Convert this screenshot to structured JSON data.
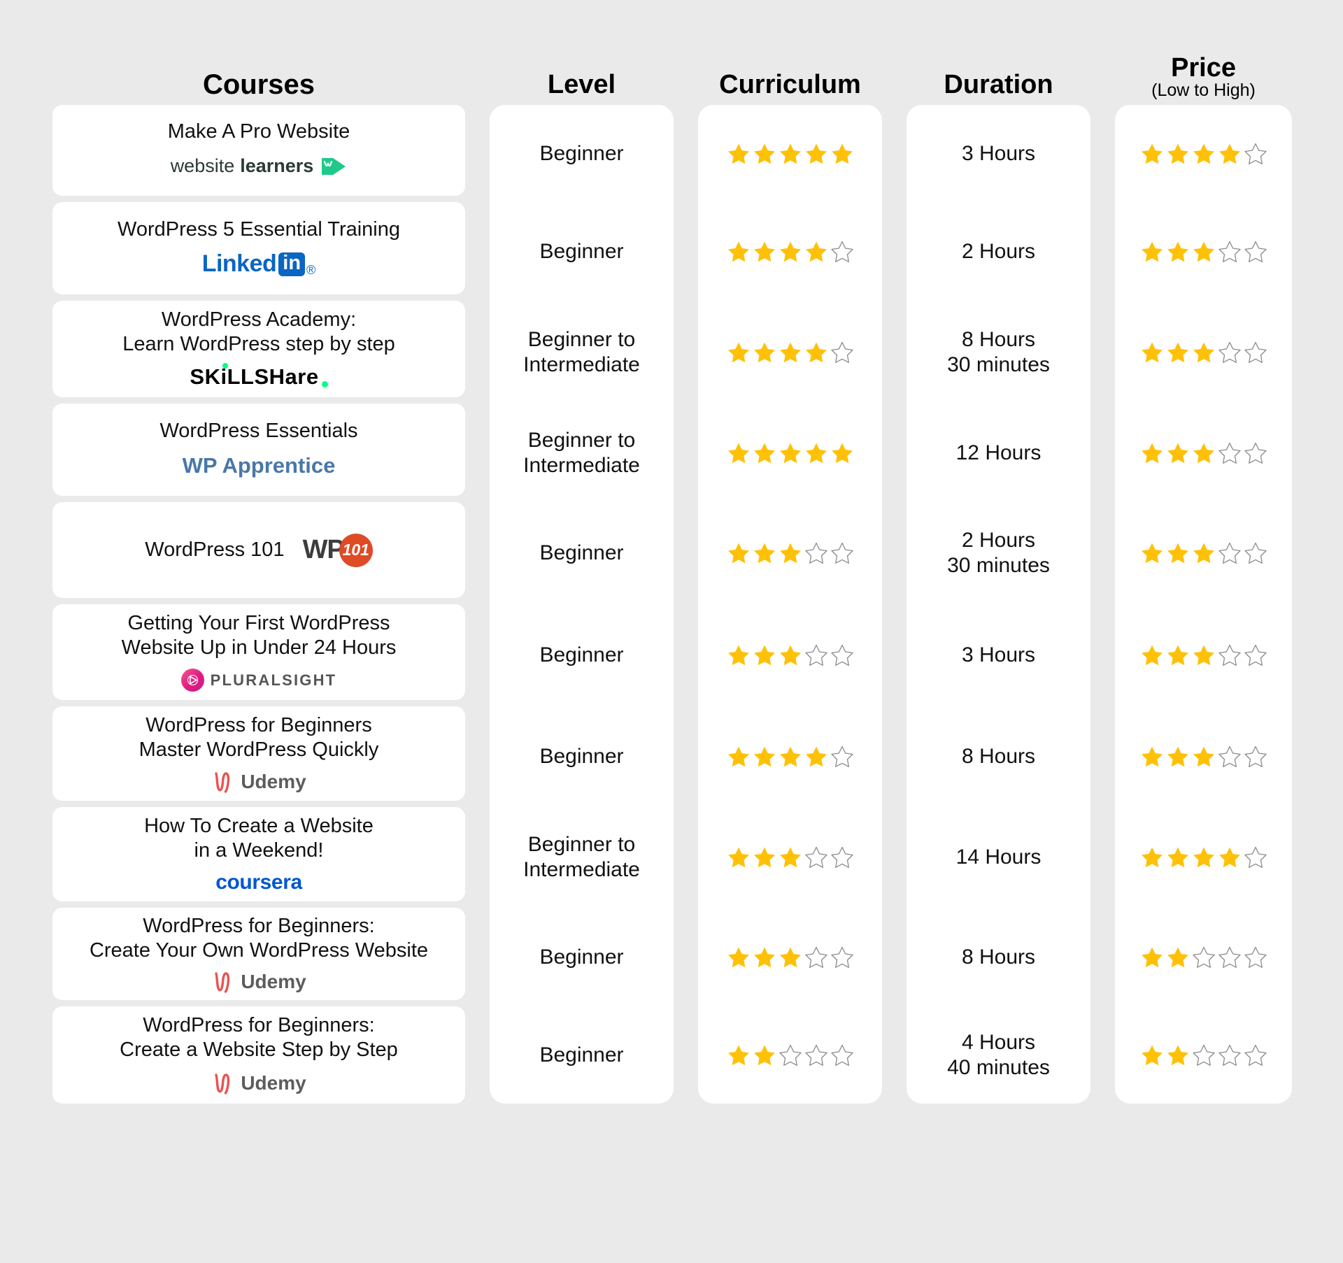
{
  "header": {
    "courses": "Courses",
    "level": "Level",
    "curriculum": "Curriculum",
    "duration": "Duration",
    "price": "Price",
    "price_sub": "(Low to High)"
  },
  "colors": {
    "page_background": "#EAEAEA",
    "card_background": "#FFFFFF",
    "star_filled": "#FFC107",
    "star_empty_stroke": "#8A8A8A",
    "text": "#111111",
    "linkedin_blue": "#0A66C2",
    "coursera_blue": "#0056D2",
    "wp_apprentice_blue": "#4A77A8",
    "wp101_orange": "#DE4B25",
    "udemy_red": "#EB5252",
    "skillshare_green": "#00FF84",
    "websitelearners_green": "#1EC98B",
    "pluralsight_pink": "#E3197F"
  },
  "rating_max": 5,
  "rows": [
    {
      "title": "Make A Pro Website",
      "provider": "websitelearners",
      "provider_icon": "websitelearners-logo",
      "level": "Beginner",
      "curriculum_rating": 5,
      "duration": "3 Hours",
      "price_rating": 4,
      "layout": "stacked"
    },
    {
      "title": "WordPress 5 Essential Training",
      "provider": "LinkedIn",
      "provider_icon": "linkedin-logo",
      "level": "Beginner",
      "curriculum_rating": 4,
      "duration": "2 Hours",
      "price_rating": 3,
      "layout": "stacked"
    },
    {
      "title": "WordPress Academy:\nLearn WordPress step by step",
      "provider": "Skillshare",
      "provider_icon": "skillshare-logo",
      "level": "Beginner to\nIntermediate",
      "curriculum_rating": 4,
      "duration": "8 Hours\n30 minutes",
      "price_rating": 3,
      "layout": "stacked"
    },
    {
      "title": "WordPress Essentials",
      "provider": "WP Apprentice",
      "provider_icon": "wp-apprentice-logo",
      "level": "Beginner to\nIntermediate",
      "curriculum_rating": 5,
      "duration": "12 Hours",
      "price_rating": 3,
      "layout": "stacked"
    },
    {
      "title": "WordPress 101",
      "provider": "WP101",
      "provider_icon": "wp101-logo",
      "level": "Beginner",
      "curriculum_rating": 3,
      "duration": "2 Hours\n30 minutes",
      "price_rating": 3,
      "layout": "inline"
    },
    {
      "title": "Getting Your First WordPress\nWebsite Up in Under 24 Hours",
      "provider": "PLURALSIGHT",
      "provider_icon": "pluralsight-logo",
      "level": "Beginner",
      "curriculum_rating": 3,
      "duration": "3 Hours",
      "price_rating": 3,
      "layout": "stacked"
    },
    {
      "title": "WordPress for Beginners\nMaster WordPress Quickly",
      "provider": "Udemy",
      "provider_icon": "udemy-logo",
      "level": "Beginner",
      "curriculum_rating": 4,
      "duration": "8 Hours",
      "price_rating": 3,
      "layout": "stacked"
    },
    {
      "title": "How To Create a Website\nin a Weekend!",
      "provider": "coursera",
      "provider_icon": "coursera-logo",
      "level": "Beginner to\nIntermediate",
      "curriculum_rating": 3,
      "duration": "14 Hours",
      "price_rating": 4,
      "layout": "stacked"
    },
    {
      "title": "WordPress for Beginners:\nCreate Your Own WordPress Website",
      "provider": "Udemy",
      "provider_icon": "udemy-logo",
      "level": "Beginner",
      "curriculum_rating": 3,
      "duration": "8 Hours",
      "price_rating": 2,
      "layout": "stacked"
    },
    {
      "title": "WordPress for Beginners:\nCreate a Website Step by Step",
      "provider": "Udemy",
      "provider_icon": "udemy-logo",
      "level": "Beginner",
      "curriculum_rating": 2,
      "duration": "4 Hours\n40 minutes",
      "price_rating": 2,
      "layout": "stacked"
    }
  ]
}
